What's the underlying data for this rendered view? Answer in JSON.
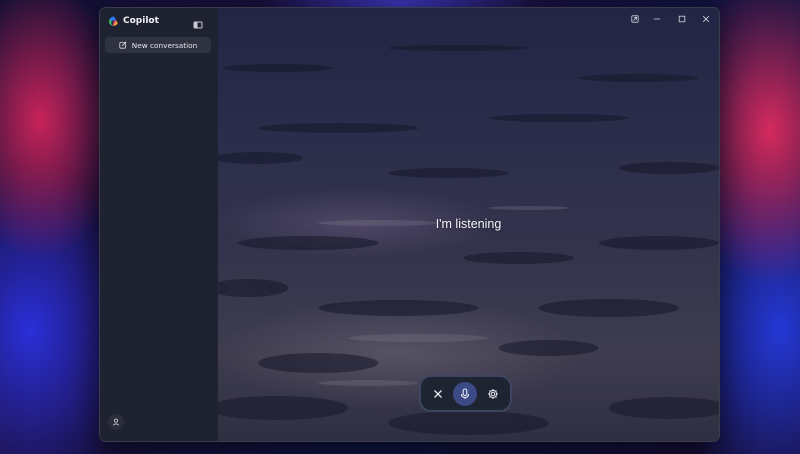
{
  "app": {
    "name": "Copilot",
    "logo_icon": "copilot-logo-icon"
  },
  "sidebar": {
    "toggle_icon": "sidebar-toggle-icon",
    "new_conversation_label": "New conversation",
    "new_conversation_icon": "compose-icon",
    "account_icon": "person-icon"
  },
  "titlebar": {
    "buttons": [
      "pop-out-icon",
      "minimize-icon",
      "maximize-icon",
      "close-icon"
    ]
  },
  "voice": {
    "status": "I'm listening",
    "controls": [
      "close-icon",
      "microphone-icon",
      "gear-icon"
    ],
    "active_control": "microphone"
  },
  "colors": {
    "window_bg": "#202330",
    "button_bg": "#2e3241",
    "mic_active": "#3c4a86",
    "voice_bar_border": "#3d4560"
  }
}
